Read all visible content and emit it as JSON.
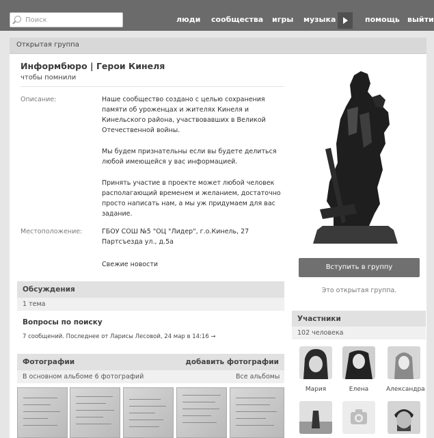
{
  "search": {
    "placeholder": "Поиск"
  },
  "nav": [
    "люди",
    "сообщества",
    "игры",
    "музыка",
    "помощь",
    "выйти"
  ],
  "group_type": "Открытая группа",
  "group": {
    "title": "Информбюро | Герои Кинеля",
    "subtitle": "чтобы помнили"
  },
  "info": {
    "description_label": "Описание:",
    "description": [
      "Наше сообщество создано с целью сохранения",
      "памяти об уроженцах и жителях Кинеля и",
      "Кинельского района, участвовавших в Великой",
      "Отечественной войны.",
      "",
      "Мы будем признательны если вы будете делиться",
      "любой имеющейся у вас информацией.",
      "",
      "Принять участие в проекте может любой человек",
      "располагающий временем и желанием, достаточно",
      "просто написать нам, а мы уж придумаем для вас",
      "задание."
    ],
    "location_label": "Местоположение:",
    "location_line1": "ГБОУ СОШ №5 \"ОЦ \"Лидер\", г.о.Кинель, 27",
    "location_line2": "Партсъезда ул., д.5а",
    "news_link": "Свежие новости"
  },
  "join_button": "Вступить в группу",
  "open_group_text": "Это открытая группа.",
  "discussions": {
    "header": "Обсуждения",
    "count": "1 тема",
    "topic_title": "Вопросы по поиску",
    "topic_meta": "7 сообщений. Последнее от Ларисы Лесовой, 24 мар в 14:16 →"
  },
  "photos": {
    "header": "Фотографии",
    "add": "добавить фотографии",
    "album_info": "В основном альбоме 6 фотографий",
    "all_albums": "Все альбомы"
  },
  "members": {
    "header": "Участники",
    "count": "102 человека",
    "names": [
      "Мария",
      "Елена",
      "Александра"
    ]
  },
  "icons": [
    "search-icon",
    "play-icon",
    "camera-icon",
    "arrow-right-icon"
  ],
  "colors": {
    "topbar": "#6b6b6b",
    "join_button": "#707070",
    "page": "#ffffff"
  }
}
